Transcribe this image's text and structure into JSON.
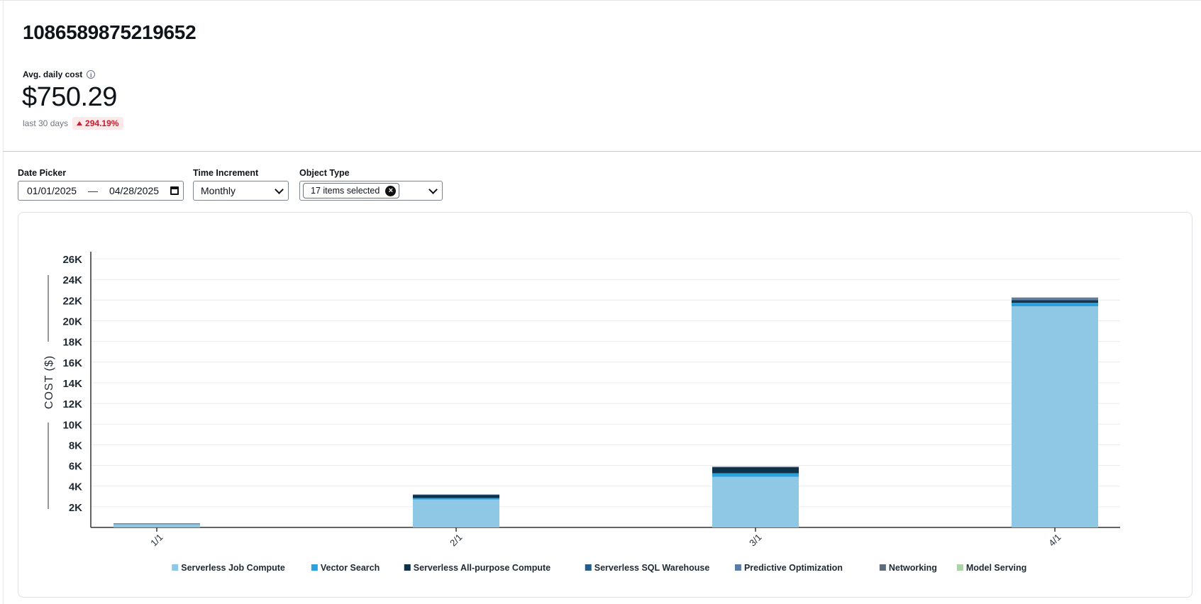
{
  "header": {
    "account_id": "1086589875219652"
  },
  "metric": {
    "label": "Avg. daily cost",
    "value": "$750.29",
    "period": "last 30 days",
    "change": "294.19%",
    "change_color": "#c81d2c"
  },
  "filters": {
    "date_picker": {
      "label": "Date Picker",
      "start": "01/01/2025",
      "separator": "—",
      "end": "04/28/2025"
    },
    "time_increment": {
      "label": "Time Increment",
      "value": "Monthly"
    },
    "object_type": {
      "label": "Object Type",
      "value": "17 items selected"
    }
  },
  "chart_data": {
    "type": "bar",
    "stacked": true,
    "categories": [
      "1/1",
      "2/1",
      "3/1",
      "4/1"
    ],
    "ylabel": "COST ($)",
    "ylim": [
      0,
      26000
    ],
    "yticks": [
      2000,
      4000,
      6000,
      8000,
      10000,
      12000,
      14000,
      16000,
      18000,
      20000,
      22000,
      24000,
      26000
    ],
    "ytick_labels": [
      "2K",
      "4K",
      "6K",
      "8K",
      "10K",
      "12K",
      "14K",
      "16K",
      "18K",
      "20K",
      "22K",
      "24K",
      "26K"
    ],
    "grid": true,
    "legend_position": "bottom",
    "series": [
      {
        "name": "Serverless Job Compute",
        "color": "#8fc8e5",
        "values": [
          300,
          2700,
          4900,
          21400
        ]
      },
      {
        "name": "Vector Search",
        "color": "#2aa0dc",
        "values": [
          40,
          150,
          350,
          350
        ]
      },
      {
        "name": "Serverless All-purpose Compute",
        "color": "#0e3148",
        "values": [
          40,
          300,
          550,
          200
        ]
      },
      {
        "name": "Serverless SQL Warehouse",
        "color": "#245c8a",
        "values": [
          0,
          20,
          50,
          100
        ]
      },
      {
        "name": "Predictive Optimization",
        "color": "#5c7ca8",
        "values": [
          0,
          10,
          20,
          100
        ]
      },
      {
        "name": "Networking",
        "color": "#5e6b7d",
        "values": [
          0,
          10,
          10,
          100
        ]
      },
      {
        "name": "Model Serving",
        "color": "#a9d4a6",
        "values": [
          0,
          0,
          0,
          0
        ]
      }
    ]
  }
}
